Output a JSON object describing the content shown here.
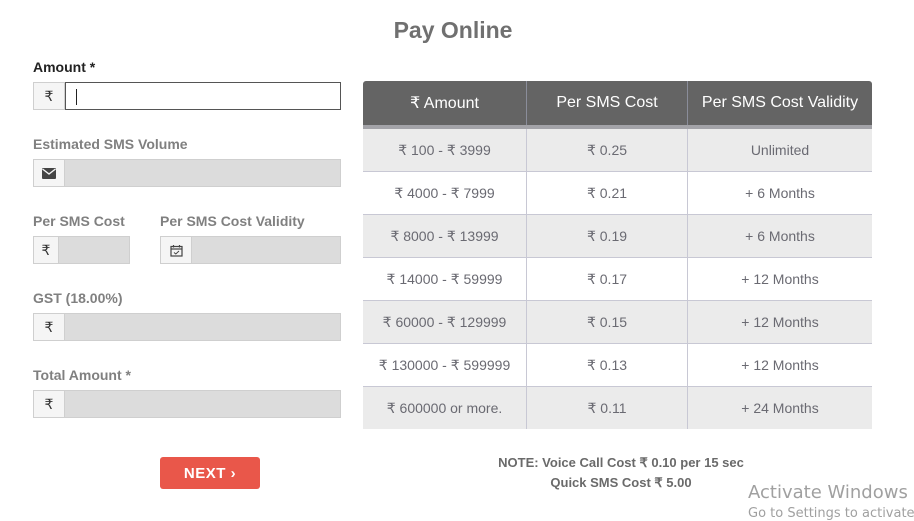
{
  "page": {
    "title": "Pay Online"
  },
  "form": {
    "amount": {
      "label": "Amount *",
      "currency_symbol": "₹",
      "value": ""
    },
    "sms_volume": {
      "label": "Estimated SMS Volume",
      "icon": "envelope-icon",
      "value": ""
    },
    "per_sms_cost": {
      "label": "Per SMS Cost",
      "currency_symbol": "₹",
      "value": ""
    },
    "validity": {
      "label": "Per SMS Cost Validity",
      "icon": "calendar-check-icon",
      "value": ""
    },
    "gst": {
      "label": "GST (18.00%)",
      "currency_symbol": "₹",
      "value": ""
    },
    "total": {
      "label": "Total Amount *",
      "currency_symbol": "₹",
      "value": ""
    },
    "next_label": "NEXT ›"
  },
  "rates_table": {
    "headers": [
      "₹ Amount",
      "Per SMS Cost",
      "Per SMS Cost Validity"
    ],
    "rows": [
      [
        "₹ 100  -  ₹ 3999",
        "₹ 0.25",
        "Unlimited"
      ],
      [
        "₹ 4000  -  ₹ 7999",
        "₹ 0.21",
        "+ 6 Months"
      ],
      [
        "₹ 8000  -  ₹ 13999",
        "₹ 0.19",
        "+ 6 Months"
      ],
      [
        "₹ 14000  -  ₹ 59999",
        "₹ 0.17",
        "+ 12 Months"
      ],
      [
        "₹ 60000  -  ₹ 129999",
        "₹ 0.15",
        "+ 12 Months"
      ],
      [
        "₹ 130000  -  ₹ 599999",
        "₹ 0.13",
        "+ 12 Months"
      ],
      [
        "₹ 600000 or more.",
        "₹ 0.11",
        "+ 24 Months"
      ]
    ]
  },
  "notes": {
    "line1": "NOTE: Voice Call Cost ₹ 0.10 per 15 sec",
    "line2": "Quick SMS Cost ₹ 5.00"
  },
  "watermark": {
    "line1": "Activate Windows",
    "line2": "Go to Settings to activate"
  }
}
